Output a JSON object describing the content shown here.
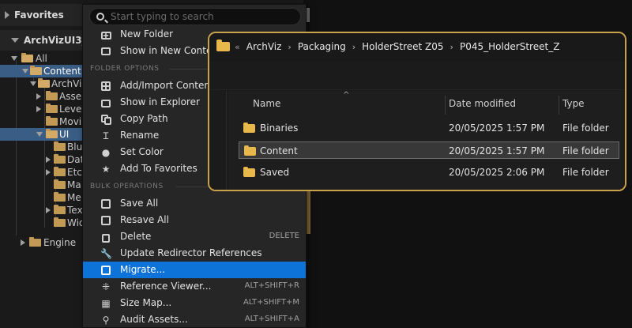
{
  "favorites_header": "Favorites",
  "project_header": "ArchVizUI3_",
  "tree": [
    {
      "label": "All"
    },
    {
      "label": "Content"
    },
    {
      "label": "ArchVi"
    },
    {
      "label": "Asse"
    },
    {
      "label": "Leve"
    },
    {
      "label": "Movi"
    },
    {
      "label": "UI"
    },
    {
      "label": "Blu"
    },
    {
      "label": "Dat"
    },
    {
      "label": "Etc"
    },
    {
      "label": "Ma"
    },
    {
      "label": "Me"
    },
    {
      "label": "Tex"
    },
    {
      "label": "Wid"
    },
    {
      "label": "Engine"
    }
  ],
  "menu": {
    "search_placeholder": "Start typing to search",
    "top_items": [
      {
        "label": "New Folder",
        "icon": "new-folder-icon"
      },
      {
        "label": "Show in New Content",
        "icon": "content-browser-icon"
      }
    ],
    "section_folder": "FOLDER OPTIONS",
    "folder_items": [
      {
        "label": "Add/Import Content",
        "icon": "add-icon"
      },
      {
        "label": "Show in Explorer",
        "icon": "explorer-icon"
      },
      {
        "label": "Copy Path",
        "icon": "copy-icon"
      },
      {
        "label": "Rename",
        "icon": "rename-icon"
      },
      {
        "label": "Set Color",
        "icon": "color-icon"
      },
      {
        "label": "Add To Favorites",
        "icon": "star-icon"
      }
    ],
    "section_bulk": "BULK OPERATIONS",
    "bulk_items": [
      {
        "label": "Save All",
        "shortcut": "",
        "icon": "save-icon"
      },
      {
        "label": "Resave All",
        "shortcut": "",
        "icon": "save-icon"
      },
      {
        "label": "Delete",
        "shortcut": "DELETE",
        "icon": "trash-icon"
      },
      {
        "label": "Update Redirector References",
        "shortcut": "",
        "icon": "wrench-icon"
      },
      {
        "label": "Migrate...",
        "shortcut": "",
        "icon": "migrate-icon"
      },
      {
        "label": "Reference Viewer...",
        "shortcut": "ALT+SHIFT+R",
        "icon": "reference-icon"
      },
      {
        "label": "Size Map...",
        "shortcut": "ALT+SHIFT+M",
        "icon": "size-map-icon"
      },
      {
        "label": "Audit Assets...",
        "shortcut": "ALT+SHIFT+A",
        "icon": "audit-icon"
      }
    ]
  },
  "explorer": {
    "breadcrumb": [
      "ArchViz",
      "Packaging",
      "HolderStreet Z05",
      "P045_HolderStreet_Z"
    ],
    "columns": {
      "name": "Name",
      "date": "Date modified",
      "type": "Type"
    },
    "rows": [
      {
        "name": "Binaries",
        "date": "20/05/2025 1:57 PM",
        "type": "File folder"
      },
      {
        "name": "Content",
        "date": "20/05/2025 1:57 PM",
        "type": "File folder"
      },
      {
        "name": "Saved",
        "date": "20/05/2025 2:06 PM",
        "type": "File folder"
      }
    ]
  },
  "colors": {
    "accent": "#0e73d8",
    "selection": "#3a5d85",
    "explorer_border": "#c8a24a",
    "folder": "#e8b84a"
  }
}
